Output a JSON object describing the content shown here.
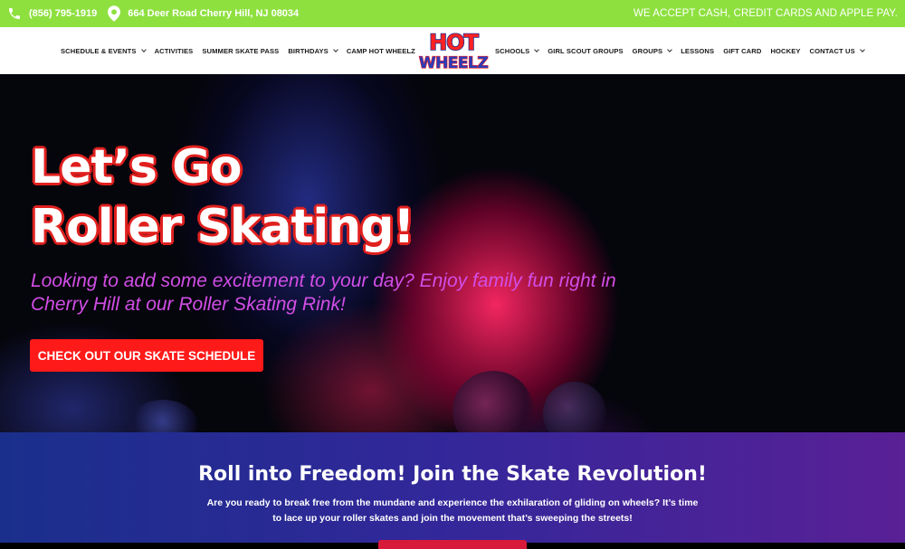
{
  "topbar": {
    "phone": "(856) 795-1919",
    "phone_icon": "phone-icon",
    "address": "664 Deer Road Cherry Hill, NJ 08034",
    "address_icon": "map-pin-icon",
    "payment_notice": "WE ACCEPT CASH, CREDIT CARDS AND APPLE PAY."
  },
  "nav": {
    "left_items": [
      {
        "label": "SCHEDULE & EVENTS",
        "dropdown": true
      },
      {
        "label": "ACTIVITIES",
        "dropdown": false
      },
      {
        "label": "SUMMER SKATE PASS",
        "dropdown": false
      },
      {
        "label": "BIRTHDAYS",
        "dropdown": true
      },
      {
        "label": "CAMP HOT WHEELZ",
        "dropdown": false
      }
    ],
    "logo": {
      "line1": "HOT",
      "line2": "WHEELZ"
    },
    "right_items": [
      {
        "label": "SCHOOLS",
        "dropdown": true
      },
      {
        "label": "GIRL SCOUT GROUPS",
        "dropdown": false
      },
      {
        "label": "GROUPS",
        "dropdown": true
      },
      {
        "label": "LESSONS",
        "dropdown": false
      },
      {
        "label": "GIFT CARD",
        "dropdown": false
      },
      {
        "label": "HOCKEY",
        "dropdown": false
      },
      {
        "label": "CONTACT US",
        "dropdown": true
      }
    ]
  },
  "hero": {
    "title_line1": "Let’s Go",
    "title_line2": "Roller Skating!",
    "subtitle": "Looking to add some excitement to your day? Enjoy family fun right in Cherry Hill at our Roller Skating Rink!",
    "cta": "CHECK OUT OUR SKATE SCHEDULE"
  },
  "promo": {
    "title": "Roll into Freedom! Join the Skate Revolution!",
    "text": "Are you ready to break free from the mundane and experience the exhilaration of gliding on wheels? It’s time to lace up your roller skates and join the movement that’s sweeping the streets!"
  },
  "colors": {
    "topbar": "#8ee03f",
    "accent_red": "#ff1a1a",
    "subtitle_magenta": "#d24ee6",
    "promo_blue": "#1a2f8c",
    "promo_purple": "#5a2096"
  }
}
